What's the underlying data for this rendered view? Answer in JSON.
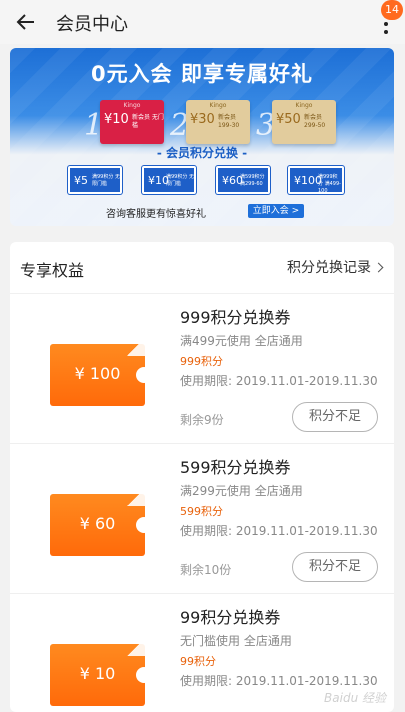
{
  "topbar": {
    "title": "会员中心",
    "badge": "14",
    "back_icon": "arrow-left-icon",
    "more_icon": "vertical-dots-icon"
  },
  "banner": {
    "headline": "0元入会  即享专属好礼",
    "steps": [
      {
        "num": "1",
        "amount": "¥10",
        "text": "新会员 无门槛",
        "logo": "Kingo"
      },
      {
        "num": "2",
        "amount": "¥30",
        "text": "新会员 199-30",
        "logo": "Kingo"
      },
      {
        "num": "3",
        "amount": "¥50",
        "text": "新会员 299-50",
        "logo": "Kingo"
      }
    ],
    "sub_title": "- 会员积分兑换 -",
    "minis": [
      {
        "amount": "¥5",
        "text": "满99积分 无限门槛"
      },
      {
        "amount": "¥10",
        "text": "满99积分 无限门槛"
      },
      {
        "amount": "¥60",
        "text": "满599积分 满299-60"
      },
      {
        "amount": "¥100",
        "text": "满999积分 满499-100"
      }
    ],
    "footer_text": "咨询客服更有惊喜好礼",
    "cta": "立即入会 >"
  },
  "benefits": {
    "title": "专享权益",
    "record_link": "积分兑换记录",
    "items": [
      {
        "coupon": "¥ 100",
        "title": "999积分兑换券",
        "condition": "满499元使用 全店通用",
        "points": "999积分",
        "date": "使用期限: 2019.11.01-2019.11.30",
        "remaining": "剩余9份",
        "button": "积分不足"
      },
      {
        "coupon": "¥ 60",
        "title": "599积分兑换券",
        "condition": "满299元使用 全店通用",
        "points": "599积分",
        "date": "使用期限: 2019.11.01-2019.11.30",
        "remaining": "剩余10份",
        "button": "积分不足"
      },
      {
        "coupon": "¥ 10",
        "title": "99积分兑换券",
        "condition": "无门槛使用 全店通用",
        "points": "99积分",
        "date": "使用期限: 2019.11.01-2019.11.30",
        "remaining": "",
        "button": ""
      }
    ]
  },
  "colors": {
    "accent": "#ff6a0a",
    "banner_blue": "#1e6fd9",
    "badge": "#ff6a1f"
  },
  "watermark": "Baidu 经验"
}
